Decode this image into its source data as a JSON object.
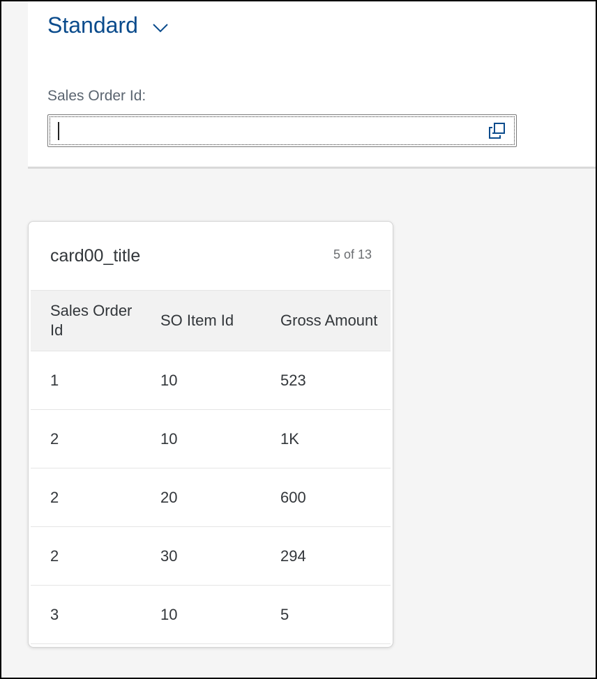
{
  "variant": {
    "title": "Standard"
  },
  "filter": {
    "label": "Sales Order Id:",
    "value": ""
  },
  "card": {
    "title": "card00_title",
    "count": "5 of 13",
    "columns": [
      "Sales Order Id",
      "SO Item Id",
      "Gross Amount"
    ],
    "rows": [
      [
        "1",
        "10",
        "523"
      ],
      [
        "2",
        "10",
        "1K"
      ],
      [
        "2",
        "20",
        "600"
      ],
      [
        "2",
        "30",
        "294"
      ],
      [
        "3",
        "10",
        "5"
      ]
    ]
  },
  "colors": {
    "accent": "#0a4b8c",
    "text": "#32363a",
    "header_bg": "#f2f2f2"
  },
  "icons": {
    "variant_chevron": "chevron-down-icon",
    "value_help": "value-help-icon"
  }
}
